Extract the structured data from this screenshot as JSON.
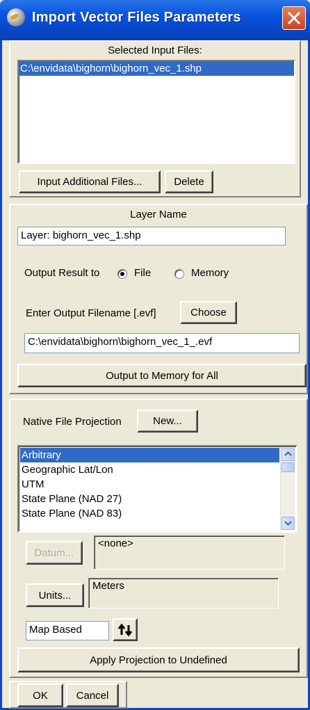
{
  "window": {
    "title": "Import Vector Files Parameters"
  },
  "input_files": {
    "heading": "Selected Input Files:",
    "files": [
      "C:\\envidata\\bighorn\\bighorn_vec_1.shp"
    ],
    "add_label": "Input Additional Files...",
    "delete_label": "Delete"
  },
  "layer": {
    "heading": "Layer Name",
    "name_value": "Layer: bighorn_vec_1.shp",
    "output_result_label": "Output Result to",
    "file_label": "File",
    "memory_label": "Memory",
    "output_selected": "File",
    "filename_label": "Enter Output Filename [.evf]",
    "choose_label": "Choose",
    "filename_value": "C:\\envidata\\bighorn\\bighorn_vec_1_.evf",
    "memory_all_label": "Output to Memory for All"
  },
  "projection": {
    "label": "Native File Projection",
    "new_label": "New...",
    "items": [
      "Arbitrary",
      "Geographic Lat/Lon",
      "UTM",
      "State Plane (NAD 27)",
      "State Plane (NAD 83)"
    ],
    "selected": "Arbitrary",
    "datum_label": "Datum...",
    "datum_value": "<none>",
    "units_label": "Units...",
    "units_value": "Meters",
    "map_based_value": "Map Based",
    "apply_label": "Apply Projection to Undefined"
  },
  "footer": {
    "ok_label": "OK",
    "cancel_label": "Cancel"
  },
  "colors": {
    "titlebar": "#0a54e0",
    "selection": "#316ac5",
    "face": "#ece9d8",
    "close": "#d8582f"
  }
}
